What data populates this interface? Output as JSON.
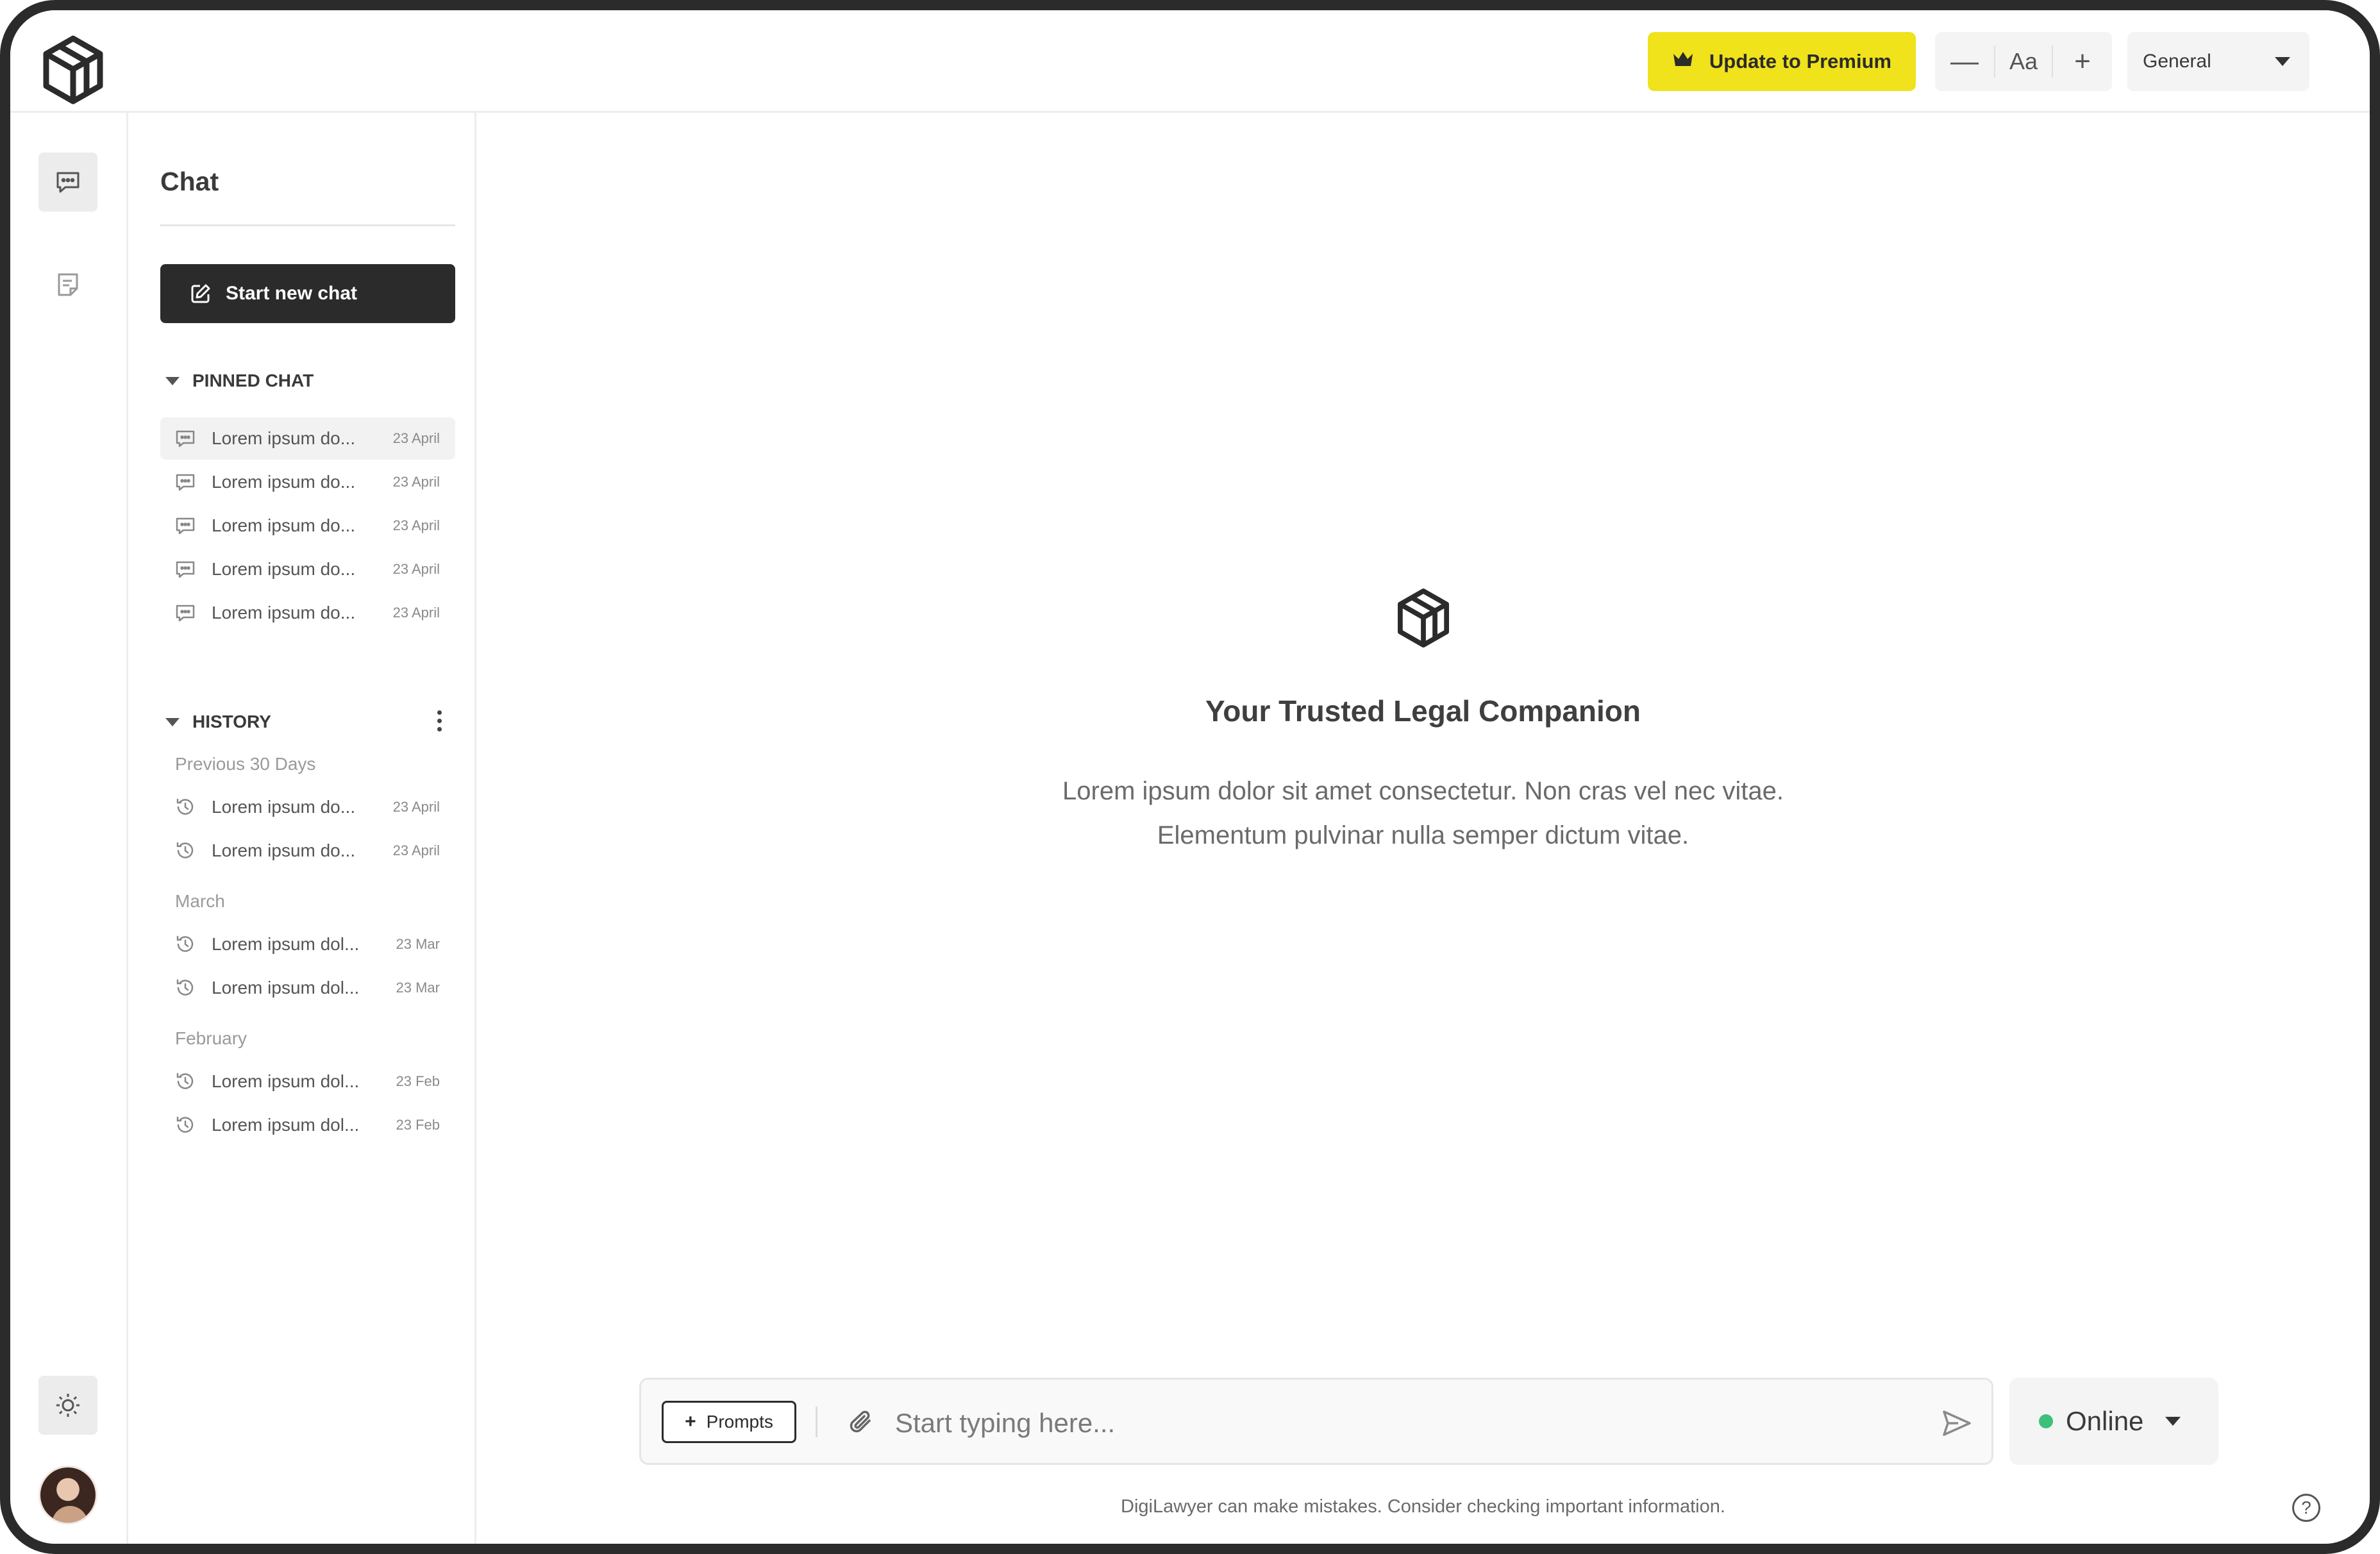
{
  "topbar": {
    "premium_label": "Update to Premium",
    "font_minus": "—",
    "font_label": "Aa",
    "font_plus": "+",
    "mode_value": "General"
  },
  "rail": {
    "items": [
      {
        "icon": "chat-bubble-icon",
        "active": true
      },
      {
        "icon": "document-icon",
        "active": false
      }
    ],
    "theme_icon": "sun-icon"
  },
  "sidebar": {
    "title": "Chat",
    "new_chat_label": "Start new chat",
    "pinned": {
      "label": "PINNED CHAT",
      "items": [
        {
          "text": "Lorem ipsum do...",
          "date": "23 April"
        },
        {
          "text": "Lorem ipsum do...",
          "date": "23 April"
        },
        {
          "text": "Lorem ipsum do...",
          "date": "23 April"
        },
        {
          "text": "Lorem ipsum do...",
          "date": "23 April"
        },
        {
          "text": "Lorem ipsum do...",
          "date": "23 April"
        }
      ]
    },
    "history": {
      "label": "HISTORY",
      "groups": [
        {
          "label": "Previous 30 Days",
          "items": [
            {
              "text": "Lorem ipsum do...",
              "date": "23 April"
            },
            {
              "text": "Lorem ipsum do...",
              "date": "23 April"
            }
          ]
        },
        {
          "label": "March",
          "items": [
            {
              "text": "Lorem ipsum dol...",
              "date": "23 Mar"
            },
            {
              "text": "Lorem ipsum dol...",
              "date": "23 Mar"
            }
          ]
        },
        {
          "label": "February",
          "items": [
            {
              "text": "Lorem ipsum dol...",
              "date": "23 Feb"
            },
            {
              "text": "Lorem ipsum dol...",
              "date": "23 Feb"
            }
          ]
        }
      ]
    }
  },
  "main": {
    "title": "Your Trusted Legal Companion",
    "subtitle_line1": "Lorem ipsum dolor sit amet consectetur. Non cras vel nec vitae.",
    "subtitle_line2": "Elementum pulvinar nulla semper dictum vitae.",
    "prompts_label": "Prompts",
    "input_placeholder": "Start typing here...",
    "status_value": "Online",
    "status_color": "#3ec07a",
    "disclaimer": "DigiLawyer can make mistakes. Consider checking important information.",
    "help_symbol": "?"
  },
  "colors": {
    "accent": "#f0e21b",
    "dark": "#2b2b2b"
  }
}
